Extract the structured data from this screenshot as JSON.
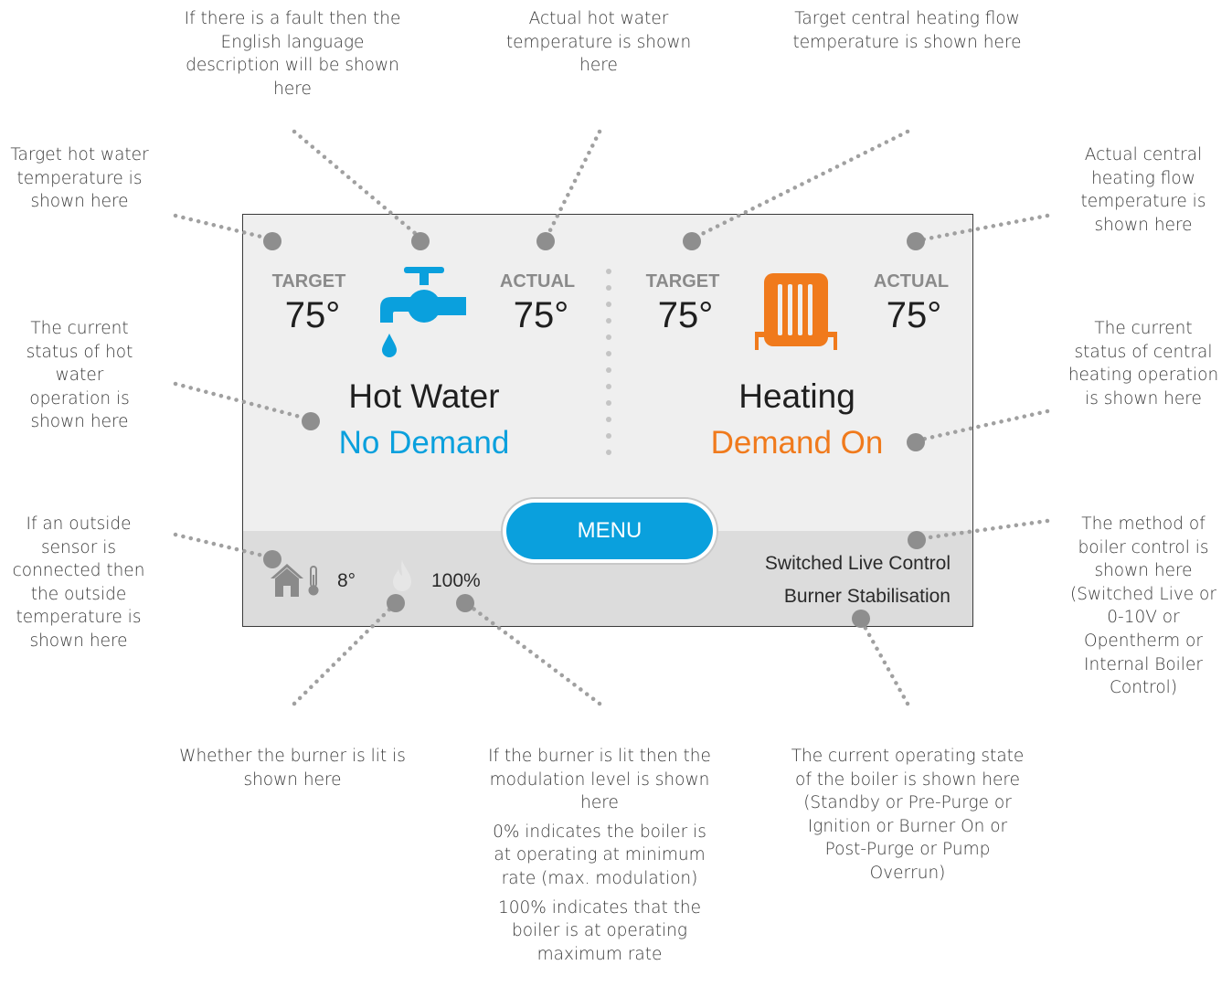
{
  "panel": {
    "hot_water": {
      "target_label": "TARGET",
      "target_temp": "75°",
      "actual_label": "ACTUAL",
      "actual_temp": "75°",
      "title": "Hot Water",
      "status": "No Demand"
    },
    "heating": {
      "target_label": "TARGET",
      "target_temp": "75°",
      "actual_label": "ACTUAL",
      "actual_temp": "75°",
      "title": "Heating",
      "status": "Demand On"
    },
    "menu_label": "MENU",
    "outside_temp": "8°",
    "modulation": "100%",
    "control_method": "Switched Live Control",
    "operating_state": "Burner Stabilisation"
  },
  "callouts": {
    "fault": "If there is a fault then the English language description will be shown here",
    "actual_hot_water": "Actual hot water temperature is shown here",
    "target_heating": "Target central heating flow temperature is shown here",
    "target_hot_water": "Target hot water temperature is shown here",
    "actual_heating": "Actual central heating flow temperature is shown here",
    "hot_water_status": "The current status of hot water operation is shown here",
    "heating_status": "The current status of central heating operation is shown here",
    "outside_sensor": "If an outside sensor is connected then the outside temperature is shown here",
    "boiler_control": "The method of boiler control is shown here (Switched Live or 0-10V or Opentherm or Internal Boiler Control)",
    "burner_lit": "Whether the burner is lit is shown here",
    "modulation_1": "If the burner is lit then the modulation level is shown here",
    "modulation_2": "0% indicates the boiler is at operating at minimum rate (max. modulation)",
    "modulation_3": "100% indicates that the boiler is at operating maximum rate",
    "operating_state": "The current operating state of the boiler is shown here (Standby or Pre-Purge or Ignition or Burner On or Post-Purge or Pump Overrun)"
  },
  "colors": {
    "hot_water_accent": "#0aa0dd",
    "heating_accent": "#f07a1c",
    "marker": "#8e8e8e",
    "icon_grey": "#8a8a8a"
  },
  "icons": [
    "tap-icon",
    "water-drop-icon",
    "radiator-icon",
    "house-icon",
    "thermometer-icon",
    "flame-icon"
  ]
}
